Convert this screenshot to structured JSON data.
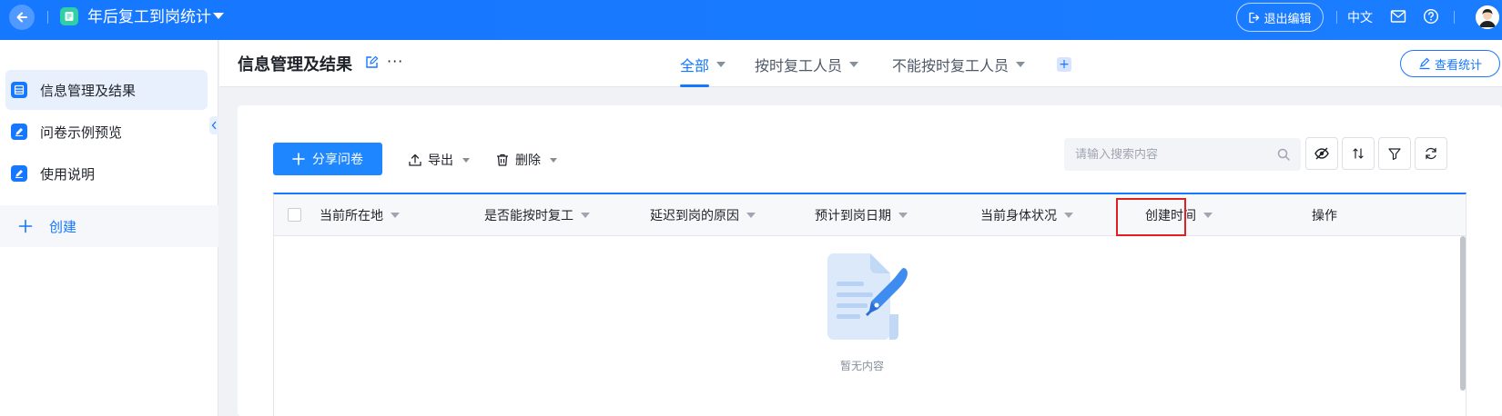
{
  "header": {
    "title": "年后复工到岗统计",
    "exit_edit_label": "退出编辑",
    "language": "中文"
  },
  "sidebar": {
    "items": [
      {
        "label": "信息管理及结果",
        "active": true
      },
      {
        "label": "问卷示例预览",
        "active": false
      },
      {
        "label": "使用说明",
        "active": false
      }
    ],
    "create_label": "创建"
  },
  "main": {
    "title": "信息管理及结果",
    "more": "···",
    "tabs": [
      {
        "label": "全部",
        "active": true
      },
      {
        "label": "按时复工人员",
        "active": false
      },
      {
        "label": "不能按时复工人员",
        "active": false
      }
    ],
    "stats_label": "查看统计"
  },
  "toolbar": {
    "share_label": "分享问卷",
    "export_label": "导出",
    "delete_label": "删除",
    "search_placeholder": "请输入搜索内容"
  },
  "table": {
    "columns": [
      "当前所在地",
      "是否能按时复工",
      "延迟到岗的原因",
      "预计到岗日期",
      "当前身体状况",
      "",
      "创建时间",
      "操作"
    ],
    "empty_text": "暂无内容"
  },
  "colors": {
    "primary": "#1677ff",
    "highlight": "#e02020"
  }
}
